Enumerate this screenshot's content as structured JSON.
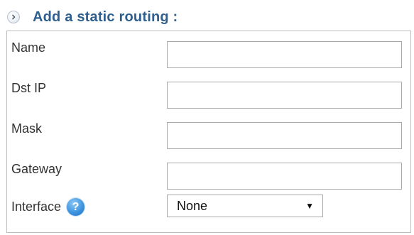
{
  "section": {
    "title": "Add a static routing :",
    "icon": "chevron-right-circle-icon"
  },
  "form": {
    "fields": [
      {
        "label": "Name",
        "value": ""
      },
      {
        "label": "Dst IP",
        "value": ""
      },
      {
        "label": "Mask",
        "value": ""
      },
      {
        "label": "Gateway",
        "value": ""
      }
    ],
    "interface": {
      "label": "Interface",
      "help_icon": "question-mark-icon",
      "help_glyph": "?",
      "selected": "None",
      "caret": "▼"
    }
  },
  "colors": {
    "title": "#2e5f8f",
    "border": "#bdbdbd",
    "help_icon": "#3f95e0"
  }
}
